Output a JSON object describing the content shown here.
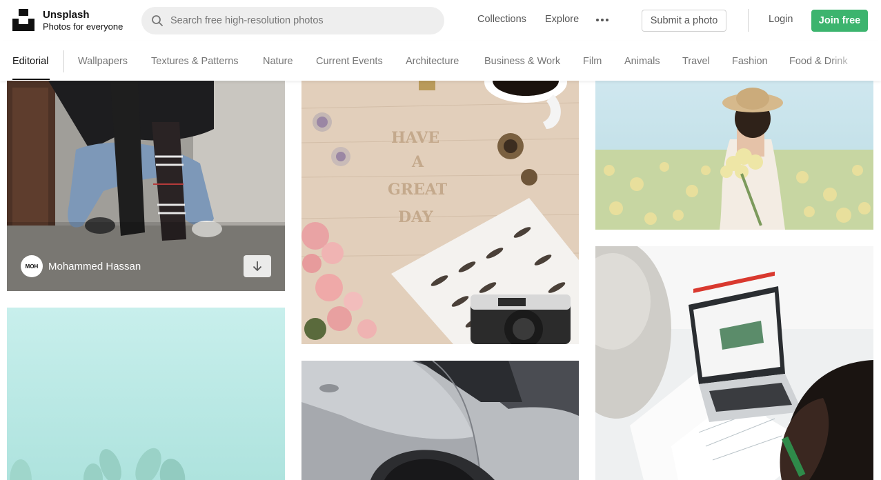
{
  "header": {
    "brand_name": "Unsplash",
    "brand_tagline": "Photos for everyone",
    "search_placeholder": "Search free high-resolution photos",
    "nav": [
      "Collections",
      "Explore"
    ],
    "more_icon": "ellipsis-icon",
    "submit_label": "Submit a photo",
    "login_label": "Login",
    "join_label": "Join free",
    "accent_color": "#3cb46e"
  },
  "categories": {
    "active": "Editorial",
    "items": [
      "Wallpapers",
      "Textures & Patterns",
      "Nature",
      "Current Events",
      "Architecture",
      "Business & Work",
      "Film",
      "Animals",
      "Travel",
      "Fashion",
      "Food & Drink"
    ]
  },
  "photos": {
    "featured": {
      "author_name": "Mohammed Hassan",
      "avatar_text": "MOH"
    },
    "letter_board": {
      "words": [
        "HAVE",
        "A",
        "GREAT",
        "DAY"
      ]
    }
  }
}
